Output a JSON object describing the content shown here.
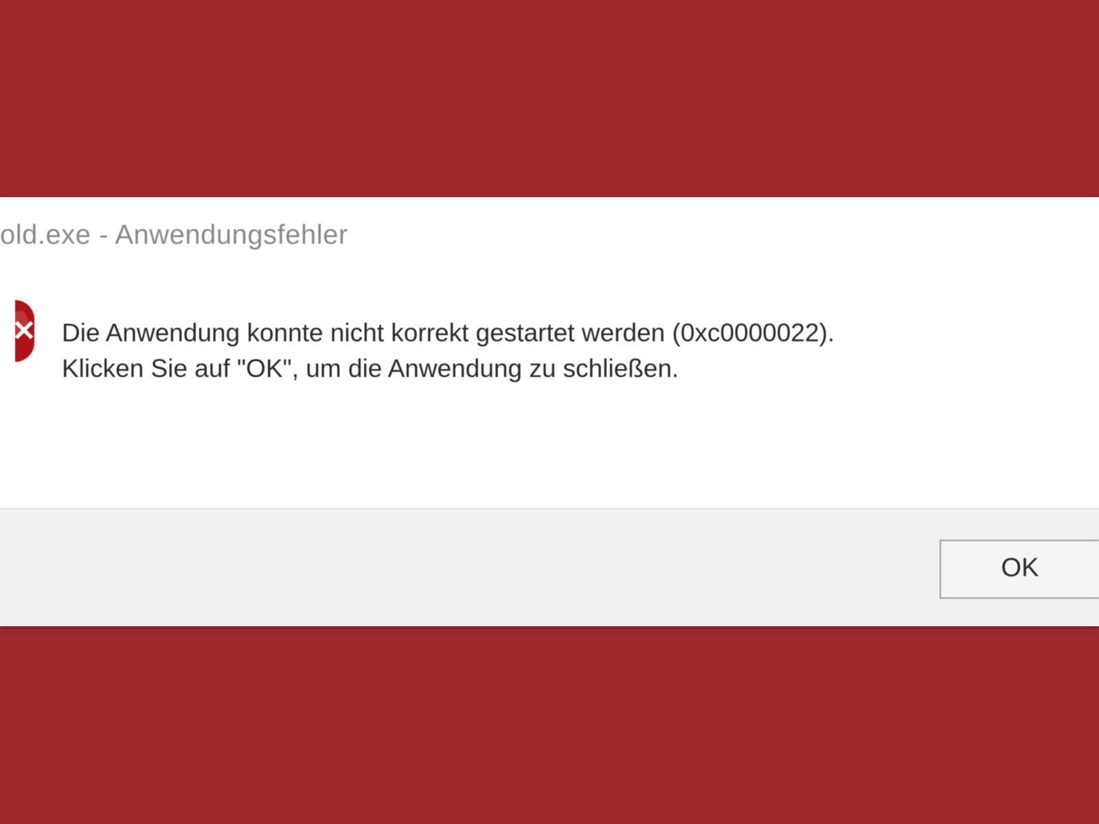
{
  "dialog": {
    "title": "old.exe - Anwendungsfehler",
    "message_line1": "Die Anwendung konnte nicht korrekt gestartet werden (0xc0000022).",
    "message_line2": "Klicken Sie auf \"OK\", um die Anwendung zu schließen.",
    "ok_label": "OK"
  },
  "colors": {
    "backdrop": "#a12a30",
    "error_icon": "#b01217",
    "button_bar": "#f1f1f1"
  }
}
